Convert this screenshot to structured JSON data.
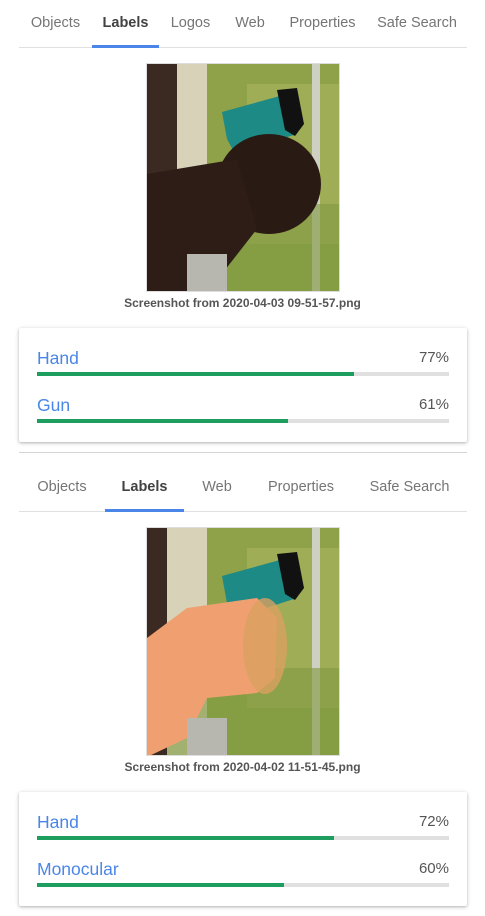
{
  "panel1": {
    "tabs": [
      "Objects",
      "Labels",
      "Logos",
      "Web",
      "Properties",
      "Safe Search"
    ],
    "active_tab": "Labels",
    "caption": "Screenshot from 2020-04-03 09-51-57.png",
    "labels": [
      {
        "name": "Hand",
        "score_text": "77%",
        "score": 0.77
      },
      {
        "name": "Gun",
        "score_text": "61%",
        "score": 0.61
      }
    ]
  },
  "panel2": {
    "tabs": [
      "Objects",
      "Labels",
      "Web",
      "Properties",
      "Safe Search"
    ],
    "active_tab": "Labels",
    "caption": "Screenshot from 2020-04-02 11-51-45.png",
    "labels": [
      {
        "name": "Hand",
        "score_text": "72%",
        "score": 0.72
      },
      {
        "name": "Monocular",
        "score_text": "60%",
        "score": 0.6
      }
    ]
  },
  "colors": {
    "accent": "#4a86e8",
    "bar": "#1e9e5e",
    "track": "#e0e0e0"
  }
}
